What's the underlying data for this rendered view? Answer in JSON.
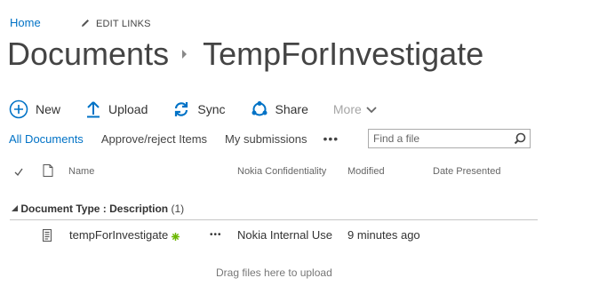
{
  "nav": {
    "home": "Home",
    "edit_links": "EDIT LINKS"
  },
  "breadcrumb": {
    "library": "Documents",
    "folder": "TempForInvestigate"
  },
  "toolbar": {
    "new": "New",
    "upload": "Upload",
    "sync": "Sync",
    "share": "Share",
    "more": "More"
  },
  "views": {
    "all_documents": "All Documents",
    "approve_reject": "Approve/reject Items",
    "my_submissions": "My submissions",
    "more": "•••"
  },
  "search": {
    "placeholder": "Find a file"
  },
  "columns": {
    "name": "Name",
    "confidentiality": "Nokia Confidentiality",
    "modified": "Modified",
    "date_presented": "Date Presented"
  },
  "group": {
    "label": "Document Type : Description",
    "count": "(1)"
  },
  "rows": [
    {
      "name": "tempForInvestigate",
      "ellipsis": "•••",
      "confidentiality": "Nokia Internal Use",
      "modified": "9 minutes ago",
      "date_presented": ""
    }
  ],
  "drag_hint": "Drag files here to upload",
  "colors": {
    "accent": "#0072c6",
    "text": "#444444",
    "disabled": "#a6a6a6",
    "new_badge": "#6bb700"
  },
  "icons": [
    "pencil-icon",
    "chevron-right-icon",
    "plus-circle-icon",
    "upload-arrow-icon",
    "sync-icon",
    "share-icon",
    "chevron-down-icon",
    "magnifier-icon",
    "checkmark-icon",
    "document-icon",
    "triangle-down-icon",
    "file-icon",
    "new-item-icon"
  ]
}
